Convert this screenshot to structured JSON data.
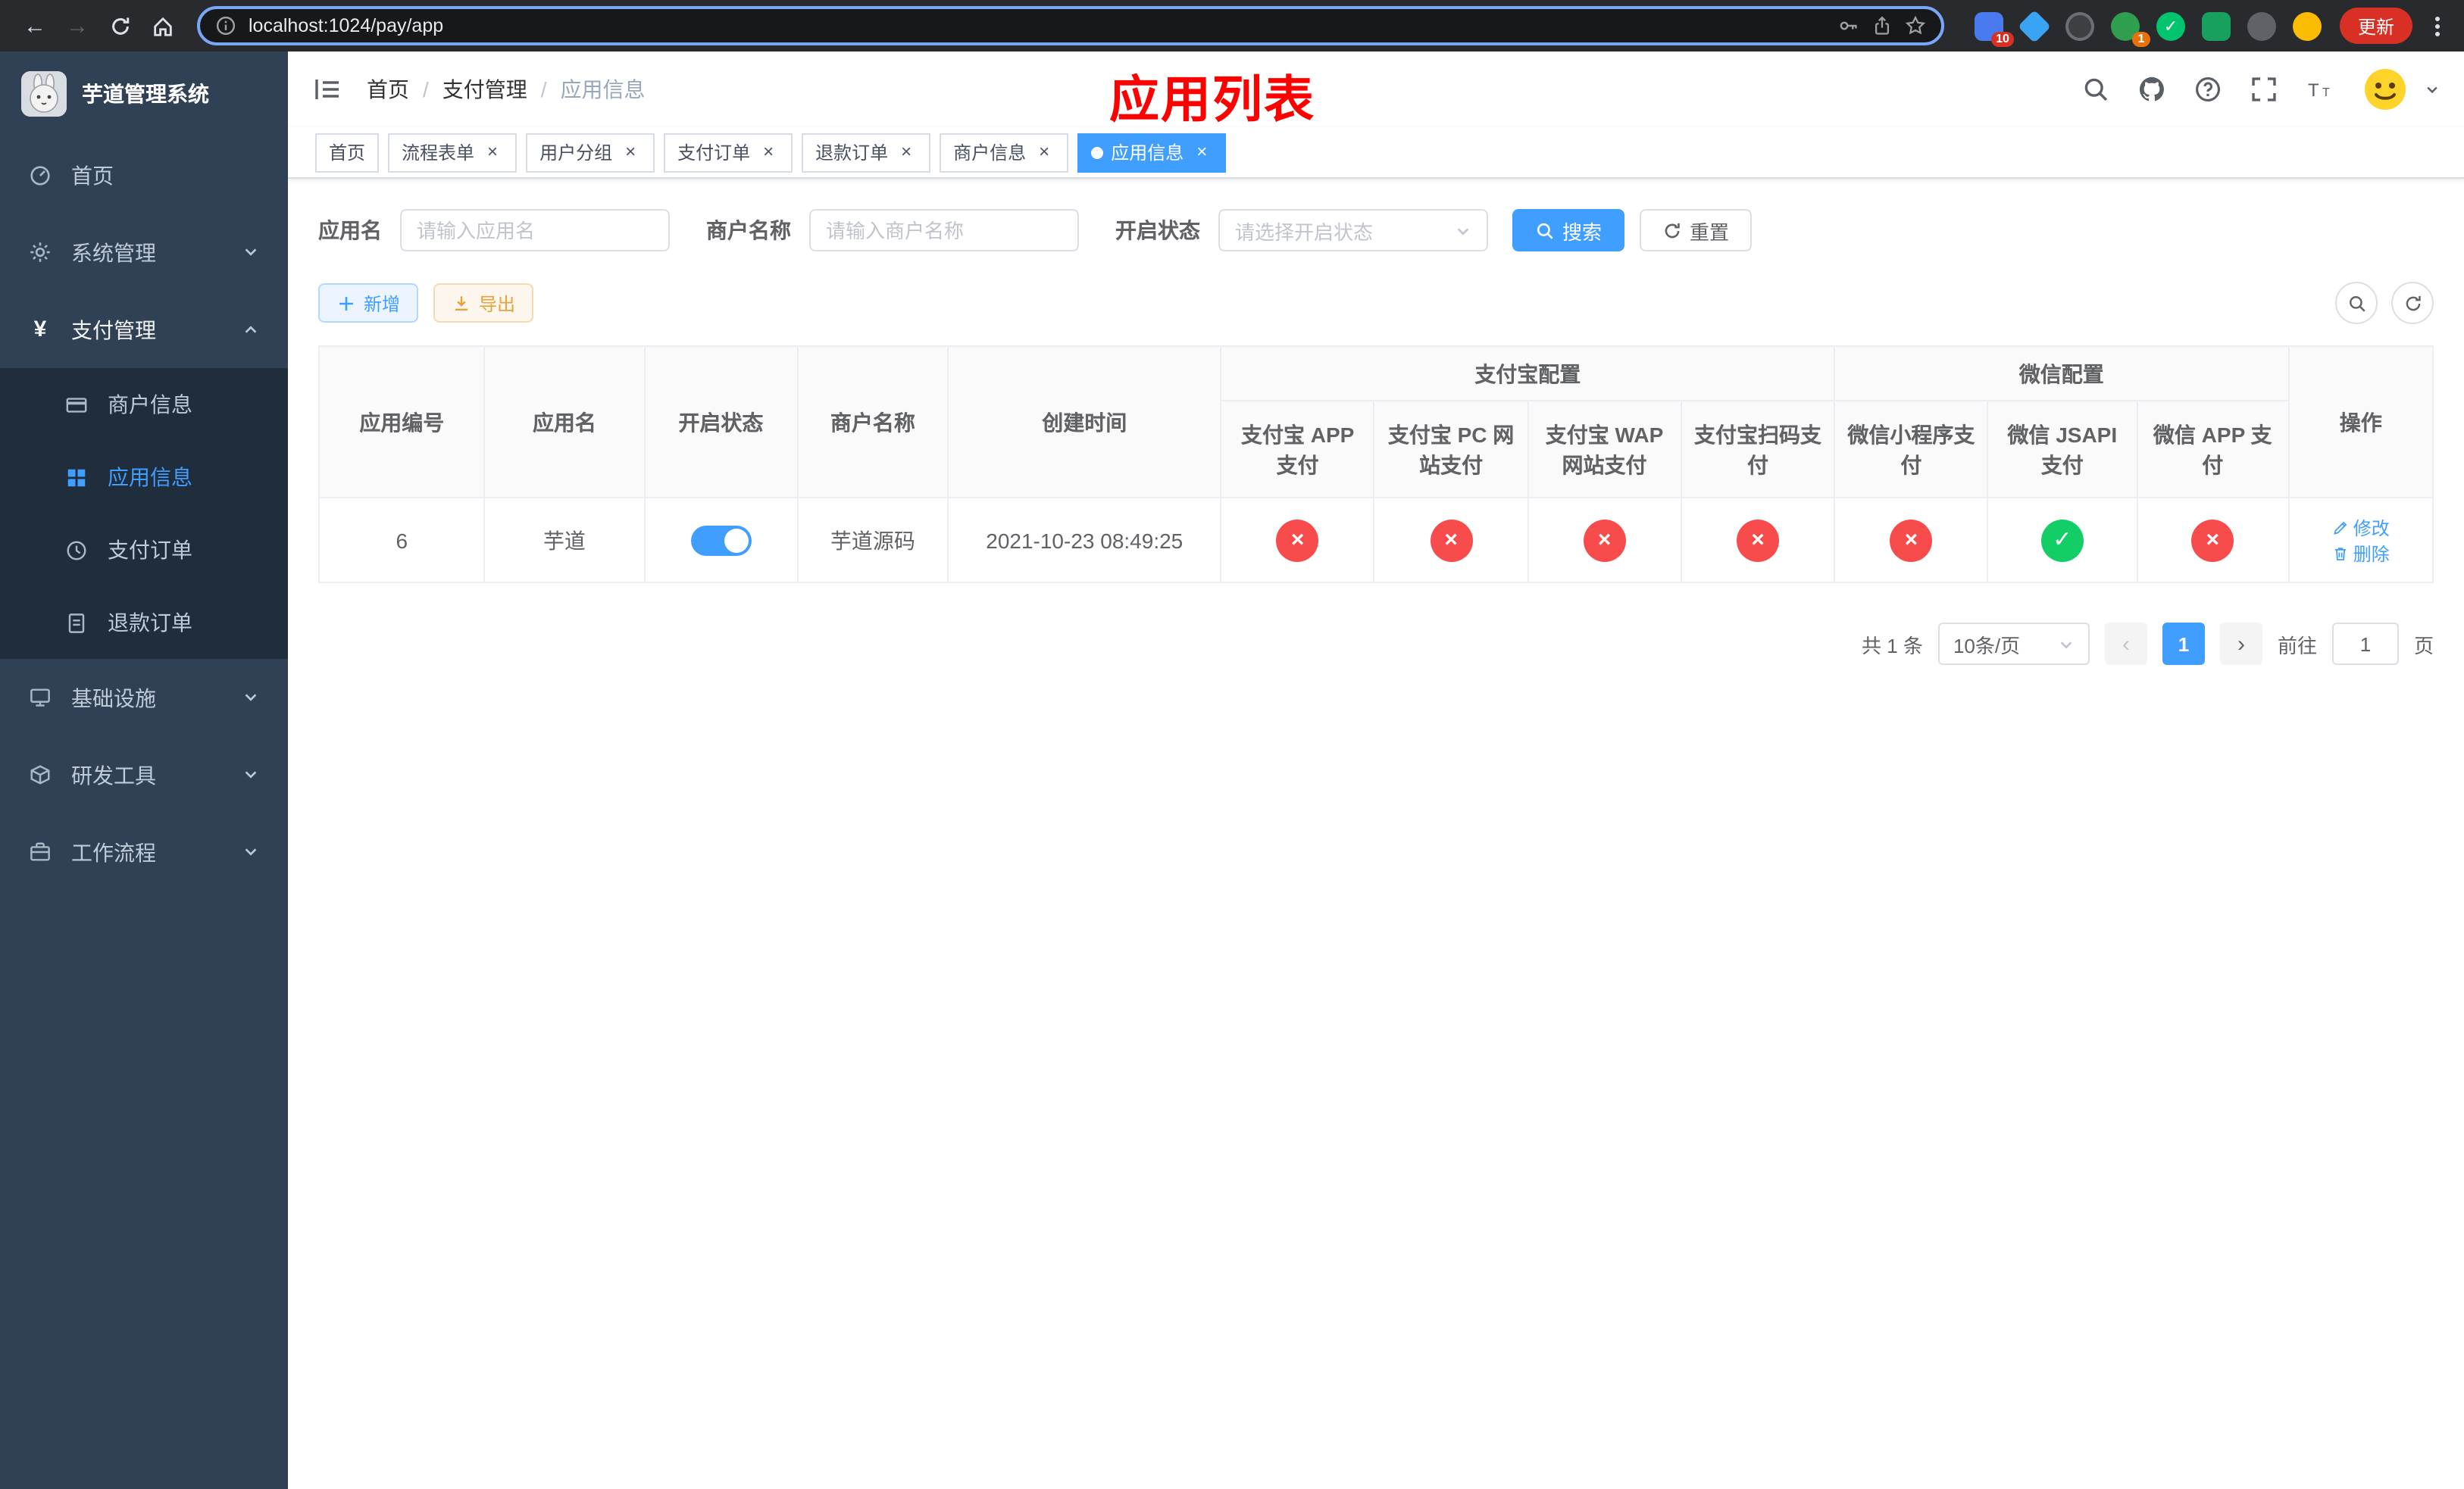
{
  "browser": {
    "url": "localhost:1024/pay/app",
    "update_label": "更新",
    "extension_badges": [
      "10",
      "1"
    ]
  },
  "sidebar": {
    "title": "芋道管理系统",
    "menu": {
      "home": "首页",
      "system": "系统管理",
      "pay": "支付管理",
      "merchant": "商户信息",
      "app": "应用信息",
      "order": "支付订单",
      "refund": "退款订单",
      "infra": "基础设施",
      "tool": "研发工具",
      "flow": "工作流程"
    }
  },
  "header": {
    "breadcrumb": {
      "home": "首页",
      "section": "支付管理",
      "current": "应用信息"
    },
    "overlay_title": "应用列表"
  },
  "tabs": {
    "items": [
      {
        "label": "首页",
        "closable": false,
        "active": false
      },
      {
        "label": "流程表单",
        "closable": true,
        "active": false
      },
      {
        "label": "用户分组",
        "closable": true,
        "active": false
      },
      {
        "label": "支付订单",
        "closable": true,
        "active": false
      },
      {
        "label": "退款订单",
        "closable": true,
        "active": false
      },
      {
        "label": "商户信息",
        "closable": true,
        "active": false
      },
      {
        "label": "应用信息",
        "closable": true,
        "active": true
      }
    ]
  },
  "filters": {
    "app_name_label": "应用名",
    "app_name_placeholder": "请输入应用名",
    "merchant_label": "商户名称",
    "merchant_placeholder": "请输入商户名称",
    "status_label": "开启状态",
    "status_placeholder": "请选择开启状态",
    "search_label": "搜索",
    "reset_label": "重置"
  },
  "toolbar": {
    "add_label": "新增",
    "export_label": "导出"
  },
  "table": {
    "columns": {
      "id": "应用编号",
      "name": "应用名",
      "status": "开启状态",
      "merchant": "商户名称",
      "created": "创建时间",
      "alipay_group": "支付宝配置",
      "alipay": [
        "支付宝 APP 支付",
        "支付宝 PC 网站支付",
        "支付宝 WAP 网站支付",
        "支付宝扫码支付"
      ],
      "wechat_group": "微信配置",
      "wechat": [
        "微信小程序支付",
        "微信 JSAPI 支付",
        "微信 APP 支付"
      ],
      "actions": "操作"
    },
    "rows": [
      {
        "id": "6",
        "name": "芋道",
        "enabled": true,
        "merchant": "芋道源码",
        "created_at": "2021-10-23 08:49:25",
        "configs": [
          "error",
          "error",
          "error",
          "error",
          "error",
          "success",
          "error"
        ],
        "actions": {
          "edit": "修改",
          "delete": "删除"
        }
      }
    ]
  },
  "pagination": {
    "total": "共 1 条",
    "page_size": "10条/页",
    "page": "1",
    "goto_label": "前往",
    "goto_value": "1",
    "page_unit": "页"
  },
  "colors": {
    "primary": "#409EFF",
    "success": "#13ce66",
    "danger": "#f84c4c",
    "warning": "#e6a23c",
    "sidebar-bg": "#304156",
    "submenu-bg": "#1f2d3d",
    "title-red": "#ff0000"
  }
}
